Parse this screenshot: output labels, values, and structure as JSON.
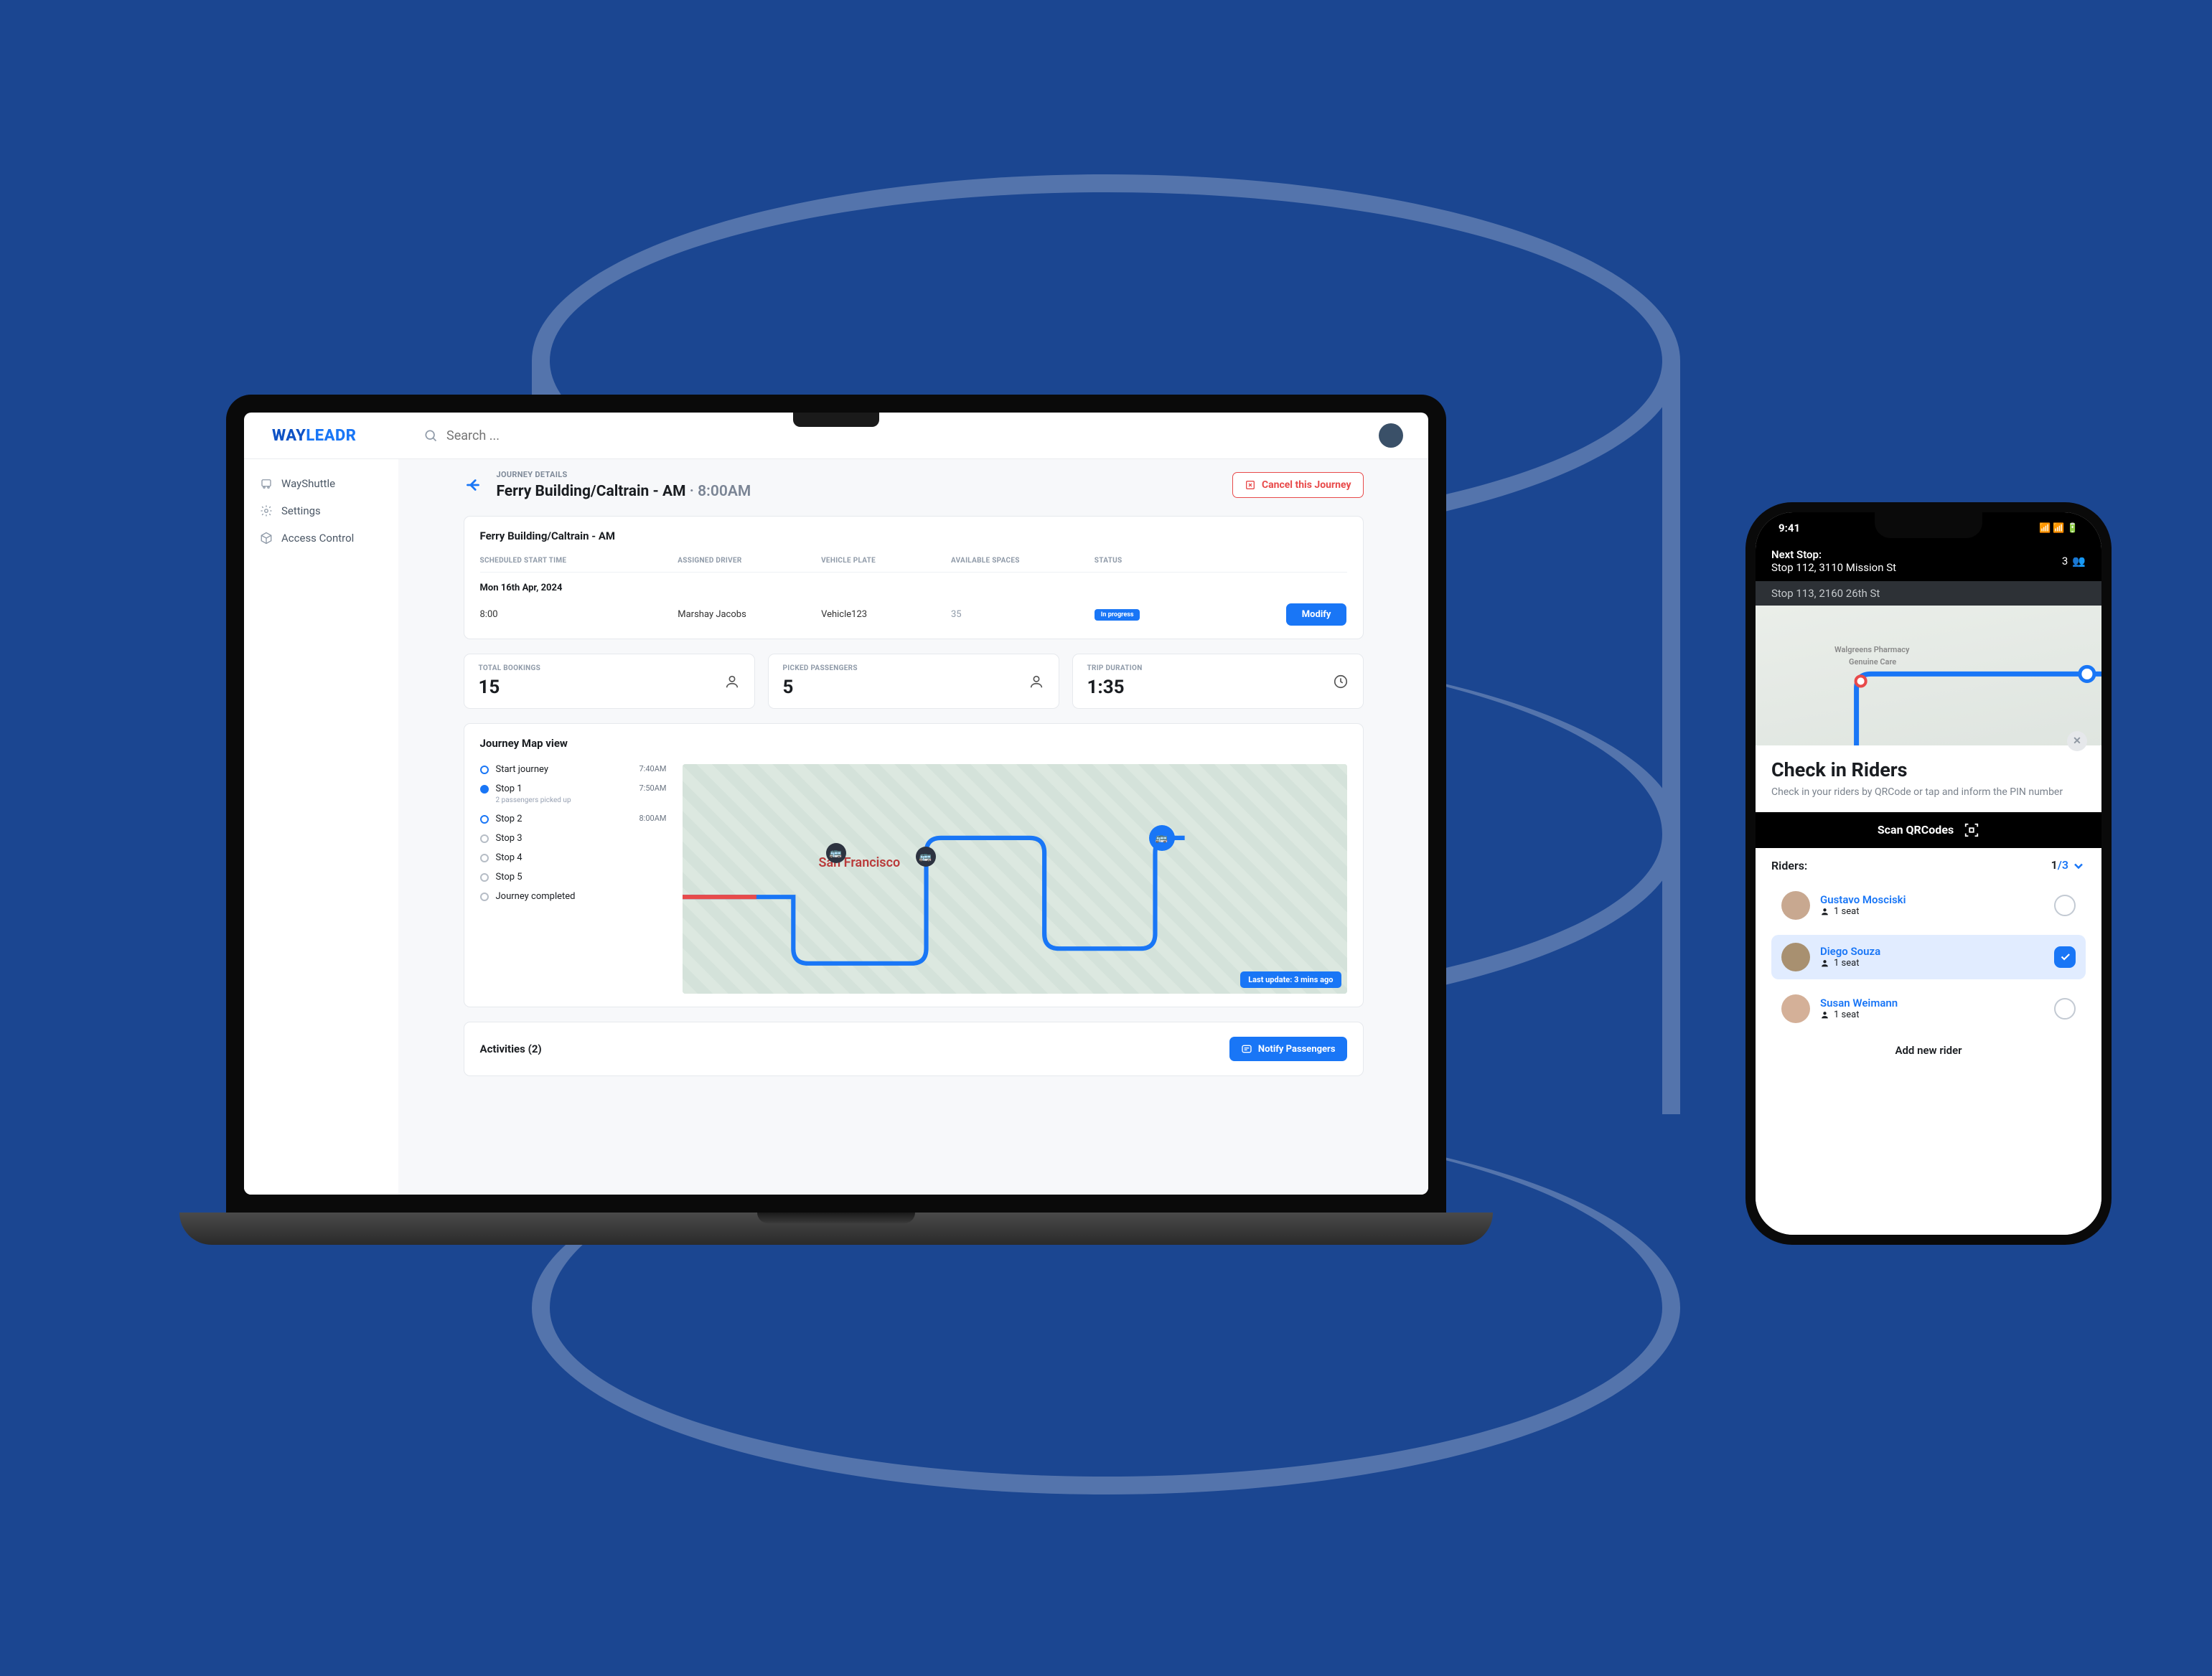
{
  "logo": {
    "first": "WAY",
    "second": "LEADR"
  },
  "search": {
    "placeholder": "Search ..."
  },
  "sidebar": {
    "items": [
      {
        "label": "WayShuttle"
      },
      {
        "label": "Settings"
      },
      {
        "label": "Access Control"
      }
    ]
  },
  "header": {
    "crumb": "JOURNEY DETAILS",
    "title": "Ferry Building/Caltrain - AM",
    "sep": " · ",
    "time": "8:00AM",
    "cancel": "Cancel this Journey"
  },
  "table": {
    "title": "Ferry Building/Caltrain - AM",
    "cols": [
      "SCHEDULED START TIME",
      "ASSIGNED DRIVER",
      "VEHICLE PLATE",
      "AVAILABLE SPACES",
      "STATUS",
      ""
    ],
    "date": "Mon 16th Apr, 2024",
    "row": {
      "time": "8:00",
      "driver": "Marshay Jacobs",
      "plate": "Vehicle123",
      "spaces": "35",
      "status": "In progress",
      "modify": "Modify"
    }
  },
  "stats": [
    {
      "label": "TOTAL BOOKINGS",
      "value": "15"
    },
    {
      "label": "PICKED PASSENGERS",
      "value": "5"
    },
    {
      "label": "TRIP DURATION",
      "value": "1:35"
    }
  ],
  "map": {
    "title": "Journey Map view",
    "stops": [
      {
        "label": "Start journey",
        "time": "7:40AM",
        "kind": "blue"
      },
      {
        "label": "Stop 1",
        "time": "7:50AM",
        "sub": "2 passengers picked up",
        "kind": "blue-fill"
      },
      {
        "label": "Stop 2",
        "time": "8:00AM",
        "kind": "blue"
      },
      {
        "label": "Stop 3",
        "kind": "grey"
      },
      {
        "label": "Stop 4",
        "kind": "grey"
      },
      {
        "label": "Stop 5",
        "kind": "grey"
      },
      {
        "label": "Journey completed",
        "kind": "grey"
      }
    ],
    "sf": "San Francisco",
    "lastupdate": "Last update: 3 mins ago"
  },
  "activities": {
    "title": "Activities (2)",
    "notify": "Notify Passengers"
  },
  "phone": {
    "time": "9:41",
    "next": {
      "label": "Next Stop:",
      "addr": "Stop 112, 3110 Mission St",
      "seats": "3"
    },
    "next2": "Stop 113, 2160 26th St",
    "mapLabels": {
      "pharmacy": "Walgreens Pharmacy",
      "care": "Genuine Care"
    },
    "sheet": {
      "title": "Check in Riders",
      "sub": "Check in your riders by QRCode or tap and inform the PIN number",
      "scan": "Scan QRCodes",
      "ridersLabel": "Riders:",
      "ridersCount": "1",
      "ridersTotal": "/3",
      "riders": [
        {
          "name": "Gustavo Mosciski",
          "seat": "1 seat"
        },
        {
          "name": "Diego Souza",
          "seat": "1 seat"
        },
        {
          "name": "Susan Weimann",
          "seat": "1 seat"
        }
      ],
      "add": "Add new rider"
    }
  }
}
